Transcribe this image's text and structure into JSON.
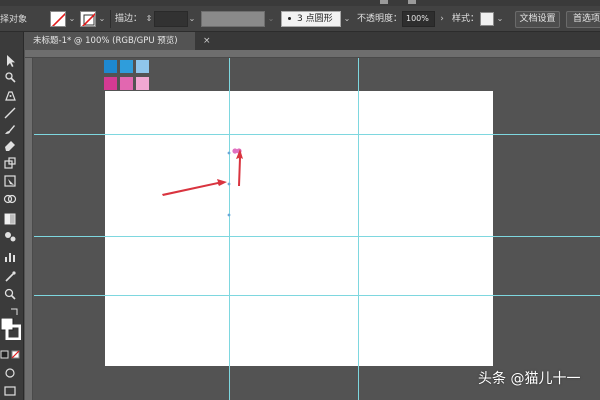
{
  "control_bar": {
    "left_label": "择对象",
    "stroke_label": "描边：",
    "stroke_weight": "",
    "brush_points": "3",
    "brush_shape": "点圆形",
    "opacity_label": "不透明度：",
    "opacity_value": "100%",
    "style_label": "样式：",
    "doc_settings_label": "文档设置",
    "preferences_label": "首选项"
  },
  "document": {
    "tab_title": "未标题-1* @ 100% (RGB/GPU 预览)",
    "tab_close": "×"
  },
  "swatches": {
    "top_row": [
      "#1e88d0",
      "#2f9ddb",
      "#8fc6ec"
    ],
    "bottom_row": [
      "#d43a93",
      "#e267b0",
      "#f1a8d2"
    ]
  },
  "colors": {
    "guide": "#7ed7df",
    "arrow": "#d9343f",
    "selection": "#e070c0"
  },
  "watermark": "头条 @猫儿十一"
}
